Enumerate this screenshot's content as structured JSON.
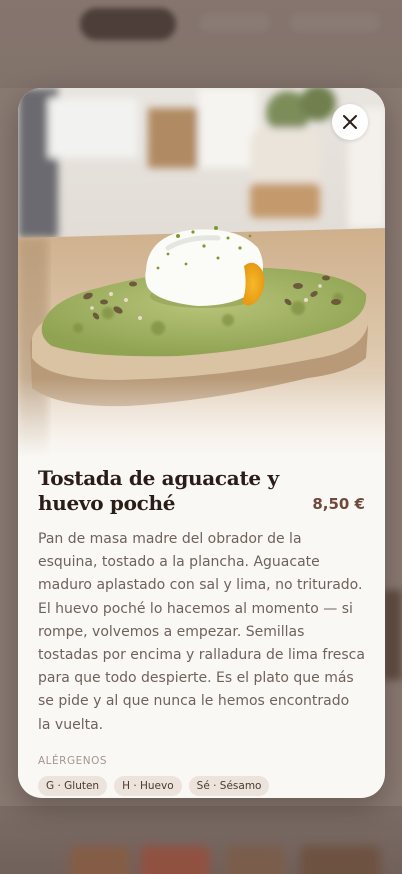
{
  "dish": {
    "title": "Tostada de aguacate y huevo poché",
    "price": "8,50 €",
    "description": "Pan de masa madre del obrador de la esquina, tostado a la plancha. Aguacate maduro aplastado con sal y lima, no triturado. El huevo poché lo hacemos al momento — si rompe, volvemos a empezar. Semillas tostadas por encima y ralladura de lima fresca para que todo despierte. Es el plato que más se pide y al que nunca le hemos encontrado la vuelta."
  },
  "allergens": {
    "heading": "ALÉRGENOS",
    "items": [
      "G · Gluten",
      "H · Huevo",
      "Sé · Sésamo"
    ]
  },
  "icons": {
    "close": "close-icon"
  },
  "colors": {
    "modal_background": "#faf8f5",
    "title": "#2a1d17",
    "price": "#6e4a3a",
    "body_text": "#6f625b",
    "tag_background": "#ece3dc"
  }
}
